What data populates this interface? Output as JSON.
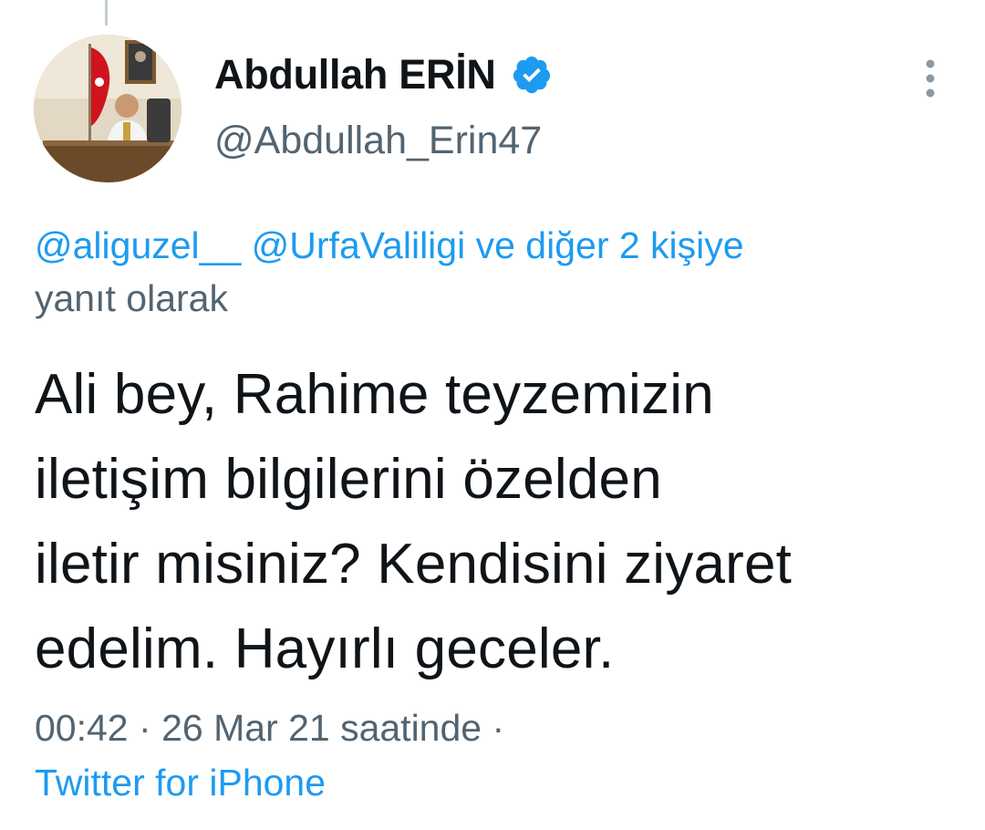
{
  "tweet": {
    "author": {
      "display_name": "Abdullah ERİN",
      "handle": "@Abdullah_Erin47",
      "verified": true
    },
    "reply_to": {
      "mentions": [
        "@aliguzel__",
        "@UrfaValiligi"
      ],
      "others_text": "ve diğer 2 kişiye",
      "suffix": "yanıt olarak"
    },
    "text_lines": [
      "Ali bey, Rahime teyzemizin",
      "iletişim bilgilerini özelden",
      "iletir misiniz? Kendisini ziyaret",
      "edelim. Hayırlı geceler."
    ],
    "time": "00:42",
    "date_text": "26 Mar 21 saatinde",
    "separator": "·",
    "source": "Twitter for iPhone"
  },
  "icons": {
    "verified": "verified-badge-icon",
    "more": "more-vertical-icon"
  },
  "colors": {
    "accent": "#1d9bf0",
    "secondary_text": "#536471",
    "primary_text": "#0f1419"
  }
}
